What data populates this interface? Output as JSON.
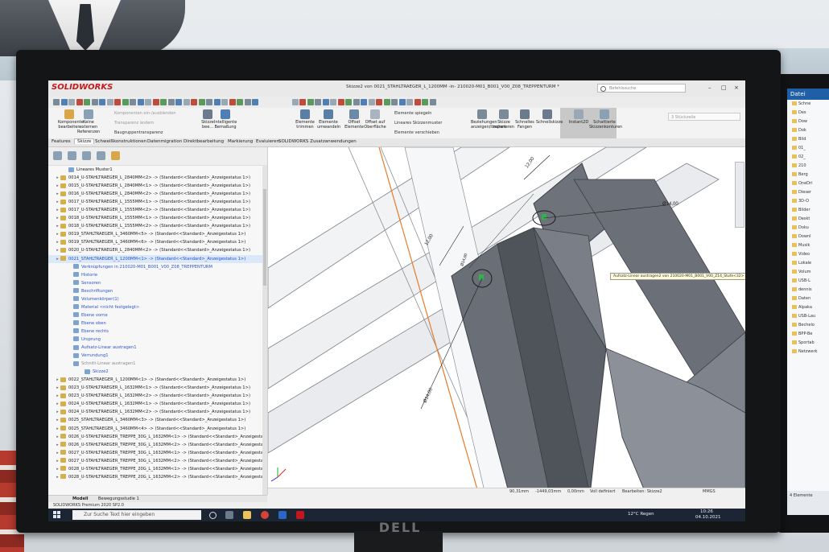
{
  "window": {
    "brand": "SOLIDWORKS",
    "title": "Skizze2 von 0021_STAHLTRAEGER_L_1200MM -in- 210020-M01_B001_V00_Z08_TREPPENTURM *",
    "search_placeholder": "Befehlssuche",
    "min": "–",
    "max": "□",
    "close": "×"
  },
  "ribbon": {
    "items": [
      "Komponente bearbeiten",
      "Keine externen Referenzen",
      "Skizze bee...",
      "Intelligente Bemaßung",
      "Elemente trimmen",
      "Elemente umwandeln",
      "Offset Elemente",
      "Offset auf Oberfläche",
      "Beziehungen anzeigen/löschen",
      "Skizze reparieren",
      "Schnelles Fangen",
      "Schnellskizze",
      "Instant2D",
      "Schattierte Skizzenkonturen"
    ],
    "small": [
      "Komponenten ein-/ausblenden",
      "Transparenz ändern",
      "Baugruppentransparenz",
      "Elemente spiegeln",
      "Lineares Skizzenmuster",
      "Elemente verschieben"
    ],
    "right_box": "3 Stückzeile"
  },
  "tabs": [
    "Features",
    "Skizze",
    "Schweißkonstruktionen",
    "Datenmigration",
    "Direktbearbeitung",
    "Markierung",
    "Evaluieren",
    "SOLIDWORKS Zusatzanwendungen"
  ],
  "tree": {
    "rows": [
      {
        "text": "Lineares Muster1",
        "type": "child"
      },
      {
        "text": "0014_U-STAHLTRAEGER_L_2840MM<2> -> (Standard<<Standard>_Anzeigestatus 1>)",
        "type": "part"
      },
      {
        "text": "0015_U-STAHLTRAEGER_L_2840MM<1> -> (Standard<<Standard>_Anzeigestatus 1>)",
        "type": "part"
      },
      {
        "text": "0016_U-STAHLTRAEGER_L_2840MM<2> -> (Standard<<Standard>_Anzeigestatus 1>)",
        "type": "part"
      },
      {
        "text": "0017_U-STAHLTRAEGER_L_1555MM<1> -> (Standard<<Standard>_Anzeigestatus 1>)",
        "type": "part"
      },
      {
        "text": "0017_U-STAHLTRAEGER_L_1555MM<2> -> (Standard<<Standard>_Anzeigestatus 1>)",
        "type": "part"
      },
      {
        "text": "0018_U-STAHLTRAEGER_L_1555MM<1> -> (Standard<<Standard>_Anzeigestatus 1>)",
        "type": "part"
      },
      {
        "text": "0018_U-STAHLTRAEGER_L_1555MM<2> -> (Standard<<Standard>_Anzeigestatus 1>)",
        "type": "part"
      },
      {
        "text": "0019_STAHLTRAEGER_L_3460MM<5> -> (Standard<<Standard>_Anzeigestatus 1>)",
        "type": "part"
      },
      {
        "text": "0019_STAHLTRAEGER_L_3460MM<6> -> (Standard<<Standard>_Anzeigestatus 1>)",
        "type": "part"
      },
      {
        "text": "0020_U-STAHLTRAEGER_L_2840MM<2> -> (Standard<<Standard>_Anzeigestatus 1>)",
        "type": "part"
      },
      {
        "text": "0021_STAHLTRAEGER_L_1200MM<1> -> (Standard<<Standard>_Anzeigestatus 1>)",
        "type": "sel"
      },
      {
        "text": "Verknüpfungen in 210020-M01_B001_V00_Z08_TREPPENTURM",
        "type": "blue"
      },
      {
        "text": "Historie",
        "type": "blue"
      },
      {
        "text": "Sensoren",
        "type": "blue"
      },
      {
        "text": "Beschriftungen",
        "type": "blue"
      },
      {
        "text": "Volumenkörper(1)",
        "type": "blue"
      },
      {
        "text": "Material <nicht festgelegt>",
        "type": "blue"
      },
      {
        "text": "Ebene vorne",
        "type": "blue"
      },
      {
        "text": "Ebene oben",
        "type": "blue"
      },
      {
        "text": "Ebene rechts",
        "type": "blue"
      },
      {
        "text": "Ursprung",
        "type": "blue"
      },
      {
        "text": "Aufsatz-Linear austragen1",
        "type": "blue"
      },
      {
        "text": "Verrundung1",
        "type": "blue"
      },
      {
        "text": "Schnitt-Linear austragen1",
        "type": "gray"
      },
      {
        "text": "Skizze2",
        "type": "blue"
      },
      {
        "text": "0022_STAHLTRAEGER_L_1200MM<1> -> (Standard<<Standard>_Anzeigestatus 1>)",
        "type": "part"
      },
      {
        "text": "0023_U-STAHLTRAEGER_L_1632MM<1> -> (Standard<<Standard>_Anzeigestatus 1>)",
        "type": "part"
      },
      {
        "text": "0023_U-STAHLTRAEGER_L_1632MM<2> -> (Standard<<Standard>_Anzeigestatus 1>)",
        "type": "part"
      },
      {
        "text": "0024_U-STAHLTRAEGER_L_1632MM<1> -> (Standard<<Standard>_Anzeigestatus 1>)",
        "type": "part"
      },
      {
        "text": "0024_U-STAHLTRAEGER_L_1632MM<2> -> (Standard<<Standard>_Anzeigestatus 1>)",
        "type": "part"
      },
      {
        "text": "0025_STAHLTRAEGER_L_3460MM<3> -> (Standard<<Standard>_Anzeigestatus 1>)",
        "type": "part"
      },
      {
        "text": "0025_STAHLTRAEGER_L_3460MM<4> -> (Standard<<Standard>_Anzeigestatus 1>)",
        "type": "part"
      },
      {
        "text": "0026_U-STAHLTRAEGER_TREPPE_30G_L_1632MM<1> -> (Standard<<Standard>_Anzeigestatus",
        "type": "part"
      },
      {
        "text": "0026_U-STAHLTRAEGER_TREPPE_30G_L_1632MM<2> -> (Standard<<Standard>_Anzeigestatus",
        "type": "part"
      },
      {
        "text": "0027_U-STAHLTRAEGER_TREPPE_30G_L_1632MM<1> -> (Standard<<Standard>_Anzeigestatus",
        "type": "part"
      },
      {
        "text": "0027_U-STAHLTRAEGER_TREPPE_30G_L_1632MM<2> -> (Standard<<Standard>_Anzeigestatus",
        "type": "part"
      },
      {
        "text": "0028_U-STAHLTRAEGER_TREPPE_20G_L_1632MM<1> -> (Standard<<Standard>_Anzeigestatus",
        "type": "part"
      },
      {
        "text": "0028_U-STAHLTRAEGER_TREPPE_20G_L_1632MM<2> -> (Standard<<Standard>_Anzeigestatus",
        "type": "part"
      }
    ],
    "bottom_tabs": [
      "Modell",
      "Bewegungsstudie 1"
    ]
  },
  "graphics": {
    "dims": [
      "12,00",
      "12,00",
      "Ø14,00",
      "Ø14,00",
      "Ø14,00"
    ],
    "tooltip": "Aufsatz-Linear austragen2 von 210020-M01_B001_V00_Z14_Stufe<32>",
    "status": {
      "x": "90,31mm",
      "y": "-1449,03mm",
      "z": "0,00mm",
      "state": "Voll definiert",
      "edit": "Bearbeiten: Skizze2",
      "units": "MMGS"
    }
  },
  "sw_status": "SOLIDWORKS Premium 2020 SP2.0",
  "taskbar": {
    "search_placeholder": "Zur Suche Text hier eingeben",
    "weather": "12°C Regen",
    "time": "10:26",
    "date": "04.10.2021"
  },
  "right_monitor": {
    "header": "Datei",
    "rows": [
      "Schne",
      "Des",
      "Dow",
      "Dok",
      "Bild",
      "01_",
      "02_",
      "210",
      "Berg",
      "OneDri",
      "Dieser",
      "3D-O",
      "Bilder",
      "Deskt",
      "Doku",
      "Downl",
      "Musik",
      "Video",
      "Lokale",
      "Volum",
      "USB-L",
      "dennis",
      "Daten",
      "Alpaka",
      "USB-Lau",
      "Bechelo",
      "BPP-Be",
      "Sportab",
      "Netzwerk"
    ],
    "footer": "4 Elemente"
  },
  "monitor_brand": "DELL"
}
